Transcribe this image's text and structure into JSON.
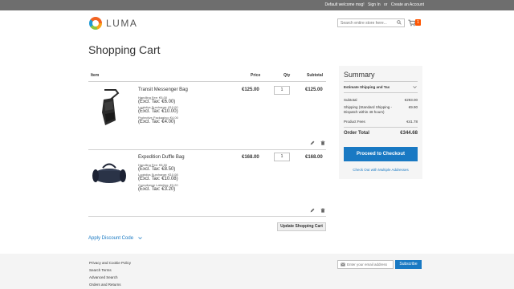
{
  "topbar": {
    "welcome": "Default welcome msg!",
    "sign_in": "Sign In",
    "or": "or",
    "create_account": "Create an Account"
  },
  "header": {
    "logo_text": "LUMA",
    "search_placeholder": "Search entire store here...",
    "cart_count": "1",
    "search_icon": "search-icon",
    "cart_icon": "cart-icon"
  },
  "page_title": "Shopping Cart",
  "table": {
    "headers": {
      "item": "Item",
      "price": "Price",
      "qty": "Qty",
      "subtotal": "Subtotal"
    },
    "items": [
      {
        "name": "Transit Messenger Bag",
        "options": [
          {
            "small": "Handling Fee: €5.00",
            "big": "(Excl. Tax: €6.00)"
          },
          {
            "small": "Logistics Surcharge: €10.00",
            "big": "(Excl. Tax: €10.00)"
          },
          {
            "small": "Protective Packaging: €4.00",
            "big": "(Excl. Tax: €4.00)"
          }
        ],
        "price": "€125.00",
        "qty": "1",
        "subtotal": "€125.00"
      },
      {
        "name": "Expedition Duffle Bag",
        "options": [
          {
            "small": "Handling Fee: €8.50",
            "big": "(Excl. Tax: €8.50)"
          },
          {
            "small": "Logistics Surcharge: €10.08",
            "big": "(Excl. Tax: €10.08)"
          },
          {
            "small": "Compliance Labeling: €3.20",
            "big": "(Excl. Tax: €3.20)"
          }
        ],
        "price": "€168.00",
        "qty": "1",
        "subtotal": "€168.00"
      }
    ],
    "update_button": "Update Shopping Cart"
  },
  "discount_label": "Apply Discount Code",
  "summary": {
    "title": "Summary",
    "estimate": "Estimate Shipping and Tax",
    "subtotal_label": "Subtotal",
    "subtotal_value": "€293.00",
    "shipping_label": "Shipping (Standard Shipping - Dispatch within 48 hours)",
    "shipping_value": "€9.90",
    "fees_label": "Product Fees",
    "fees_value": "€41.78",
    "total_label": "Order Total",
    "total_value": "€344.68",
    "checkout_button": "Proceed to Checkout",
    "multi_link": "Check Out with Multiple Addresses"
  },
  "footer": {
    "links": [
      "Privacy and Cookie Policy",
      "Search Terms",
      "Advanced Search",
      "Orders and Returns"
    ],
    "newsletter_placeholder": "Enter your email address",
    "subscribe": "Subscribe"
  },
  "colors": {
    "accent": "#1979c3",
    "cart_badge": "#ff5501",
    "topbar": "#6e6e6e"
  }
}
